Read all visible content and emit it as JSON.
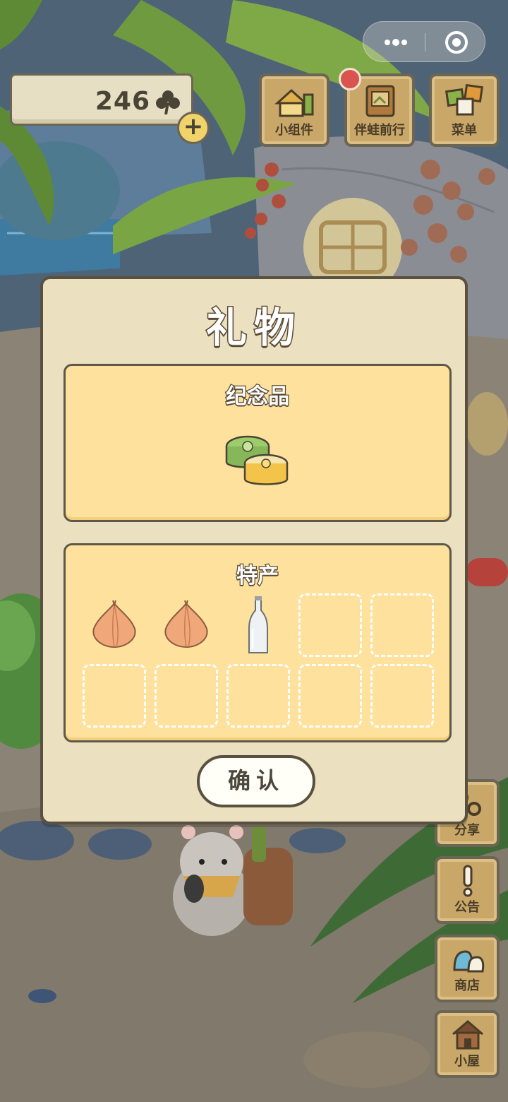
{
  "hud": {
    "clover_count": "246",
    "clover_icon": "clover-icon",
    "add_icon": "plus-icon"
  },
  "capsule": {
    "more_icon": "more-dots-icon",
    "close_icon": "target-circle-icon"
  },
  "top_buttons": [
    {
      "label": "小组件",
      "icon": "widget-icon"
    },
    {
      "label": "伴蛙前行",
      "icon": "photo-album-icon",
      "has_notification": true
    },
    {
      "label": "菜单",
      "icon": "menu-cards-icon"
    }
  ],
  "side_buttons": [
    {
      "label": "分享",
      "icon": "share-icon"
    },
    {
      "label": "公告",
      "icon": "exclamation-icon"
    },
    {
      "label": "商店",
      "icon": "shop-bags-icon"
    },
    {
      "label": "小屋",
      "icon": "house-icon"
    }
  ],
  "dialog": {
    "title": "礼物",
    "souvenir": {
      "title": "纪念品",
      "item_icon": "mooncake-icon"
    },
    "specialty": {
      "title": "特产",
      "slots": [
        {
          "item": "onion-icon"
        },
        {
          "item": "onion-icon"
        },
        {
          "item": "glass-bottle-icon"
        },
        {
          "item": null
        },
        {
          "item": null
        },
        {
          "item": null
        },
        {
          "item": null
        },
        {
          "item": null
        },
        {
          "item": null
        },
        {
          "item": null
        }
      ]
    },
    "confirm_label": "确认"
  },
  "colors": {
    "dialog_bg": "#ebe0c0",
    "section_bg": "#fde19c",
    "border": "#59503f",
    "wood": "#c9a769",
    "notify": "#d9534f"
  }
}
